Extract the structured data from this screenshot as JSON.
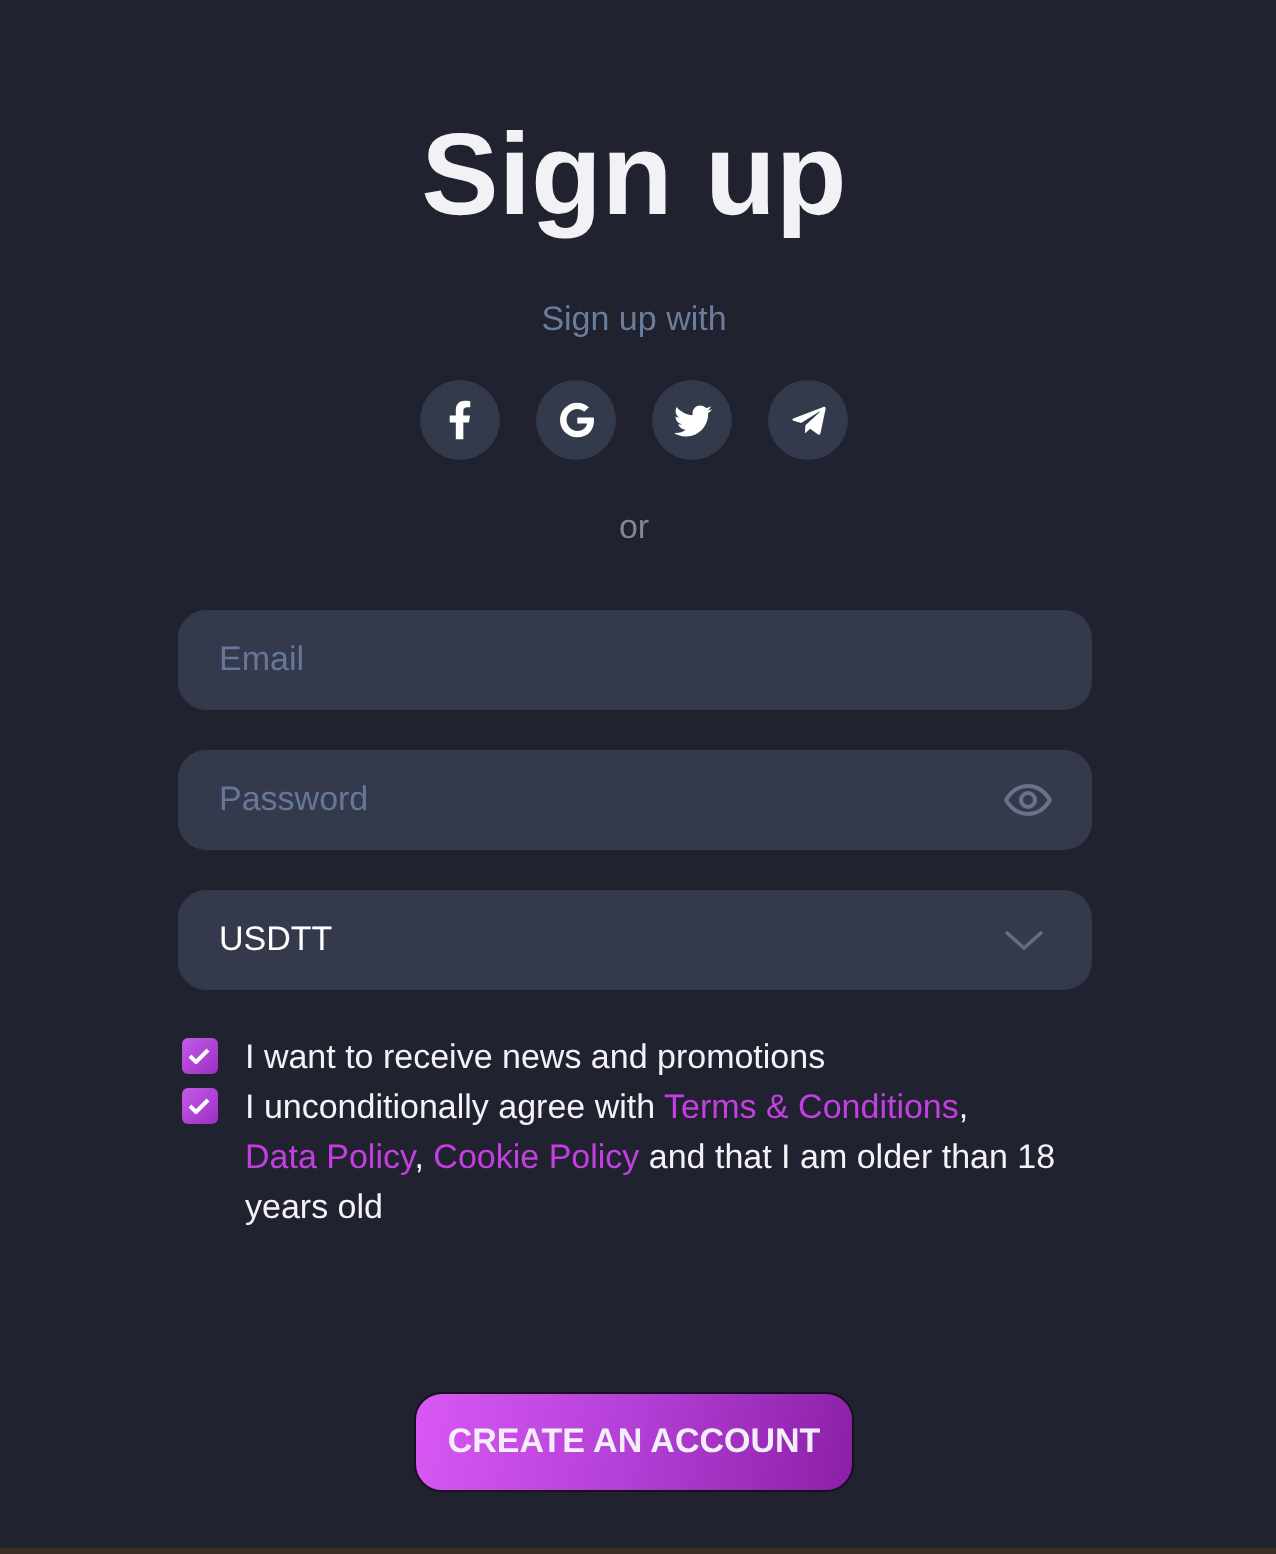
{
  "title": "Sign up",
  "social": {
    "label": "Sign up with",
    "buttons": [
      {
        "kind": "facebook"
      },
      {
        "kind": "google"
      },
      {
        "kind": "twitter"
      },
      {
        "kind": "telegram"
      }
    ]
  },
  "separator": "or",
  "form": {
    "email": {
      "placeholder": "Email"
    },
    "password": {
      "placeholder": "Password"
    },
    "currency": {
      "value": "USDTT"
    }
  },
  "consents": [
    {
      "checked": true,
      "parts": [
        {
          "kind": "text",
          "text": "I want to receive news and promotions"
        }
      ]
    },
    {
      "checked": true,
      "parts": [
        {
          "kind": "text",
          "text": "I unconditionally agree with "
        },
        {
          "kind": "link",
          "text": "Terms & Conditions"
        },
        {
          "kind": "text",
          "text": ", "
        },
        {
          "kind": "link",
          "text": "Data Policy"
        },
        {
          "kind": "text",
          "text": ", "
        },
        {
          "kind": "link",
          "text": "Cookie Policy"
        },
        {
          "kind": "text",
          "text": " and that I am older than 18 years old"
        }
      ]
    }
  ],
  "submit": "CREATE AN ACCOUNT"
}
